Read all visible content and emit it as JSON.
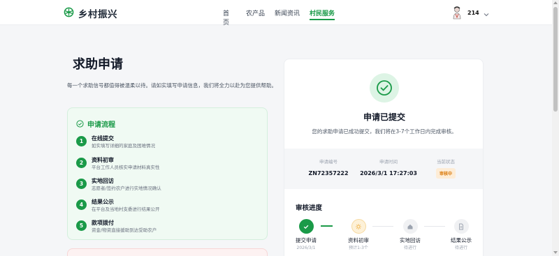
{
  "header": {
    "logo_text": "乡村振兴",
    "nav": [
      "首页",
      "农产品",
      "新闻资讯",
      "村民服务"
    ],
    "active_nav": "村民服务",
    "username": "214",
    "accent_color": "#1a9a48"
  },
  "left": {
    "title": "求助申请",
    "description": "每一个求助信号都值得被温柔以待。请如实填写申请信息，我们将全力以赴为您提供帮助。",
    "process": {
      "title": "申请流程",
      "steps": [
        {
          "num": "1",
          "title": "在线提交",
          "sub": "如实填写详细的家庭及困难情况"
        },
        {
          "num": "2",
          "title": "资料初审",
          "sub": "平台工作人员核实申请材料真实性"
        },
        {
          "num": "3",
          "title": "实地回访",
          "sub": "志愿者/签约农户进行实地情况确认"
        },
        {
          "num": "4",
          "title": "结果公示",
          "sub": "在平台及当地村支委进行结果公开"
        },
        {
          "num": "5",
          "title": "款项拨付",
          "sub": "资金/物资直接援助到达受助农户"
        }
      ]
    }
  },
  "result": {
    "title": "申请已提交",
    "description": "您的求助申请已成功提交，我们将在3-7个工作日内完成审核。",
    "info": {
      "id_label": "申请编号",
      "id_value": "ZN72357222",
      "time_label": "申请时间",
      "time_value": "2026/3/1 17:27:03",
      "status_label": "当前状态",
      "status_value": "审核中"
    },
    "progress": {
      "title": "审核进度",
      "steps": [
        {
          "label": "提交申请",
          "sub": "2026/3/1"
        },
        {
          "label": "资料初审",
          "sub": "预计1-3个"
        },
        {
          "label": "实地回访",
          "sub": "待进行"
        },
        {
          "label": "结果公示",
          "sub": "待进行"
        }
      ]
    }
  }
}
